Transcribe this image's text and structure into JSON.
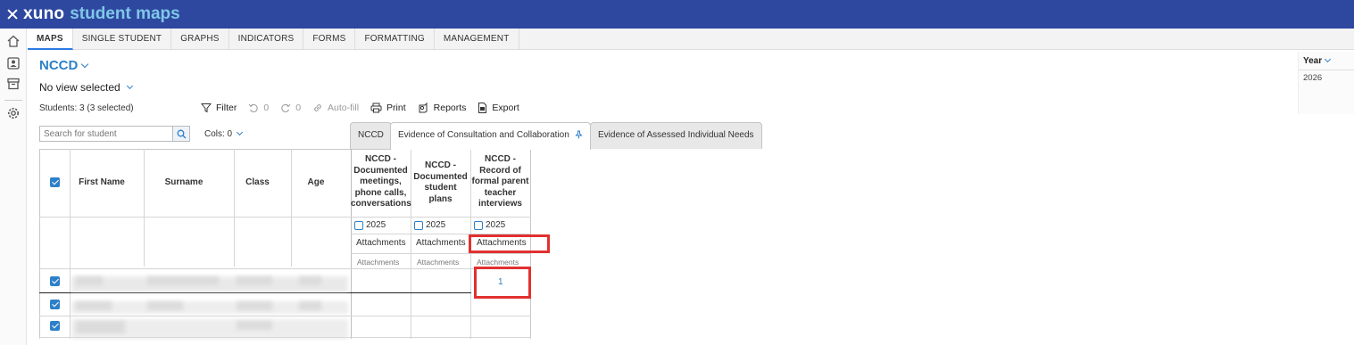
{
  "app": {
    "brand_main": "xuno",
    "brand_accent": "student maps",
    "brand_color": "#2e48a0"
  },
  "rail_icons": [
    "home-icon",
    "contact-card-icon",
    "archive-icon",
    "gear-icon"
  ],
  "tabs": [
    {
      "label": "MAPS",
      "active": true
    },
    {
      "label": "SINGLE STUDENT"
    },
    {
      "label": "GRAPHS"
    },
    {
      "label": "INDICATORS"
    },
    {
      "label": "FORMS"
    },
    {
      "label": "FORMATTING"
    },
    {
      "label": "MANAGEMENT"
    }
  ],
  "map": {
    "title": "NCCD",
    "view": "No view selected",
    "students": "Students: 3 (3 selected)"
  },
  "toolbar": {
    "filter": "Filter",
    "undo_count": "0",
    "redo_count": "0",
    "autofill": "Auto-fill",
    "print": "Print",
    "reports": "Reports",
    "export": "Export"
  },
  "year_panel": {
    "label": "Year",
    "value": "2026"
  },
  "search": {
    "placeholder": "Search for student"
  },
  "cols": {
    "label": "Cols: 0"
  },
  "sheet_tabs": [
    {
      "label": "NCCD"
    },
    {
      "label": "Evidence of Consultation and Collaboration",
      "active": true
    },
    {
      "label": "Evidence of Assessed Individual Needs"
    }
  ],
  "grid": {
    "headers": {
      "first_name": "First Name",
      "surname": "Surname",
      "class": "Class",
      "age": "Age"
    },
    "columns": [
      {
        "title_lines": [
          "NCCD -",
          "Documented",
          "meetings,",
          "phone calls,",
          "conversations"
        ],
        "year": "2025",
        "attachments": "Attachments",
        "sub": "Attachments"
      },
      {
        "title_lines": [
          "NCCD -",
          "Documented",
          "student",
          "plans"
        ],
        "year": "2025",
        "attachments": "Attachments",
        "sub": "Attachments"
      },
      {
        "title_lines": [
          "NCCD -",
          "Record of",
          "formal parent",
          "teacher",
          "interviews"
        ],
        "year": "2025",
        "attachments": "Attachments",
        "sub": "Attachments"
      }
    ],
    "row1_value": "1"
  },
  "colors": {
    "accent": "#2d80c8",
    "highlight": "#e23030"
  }
}
